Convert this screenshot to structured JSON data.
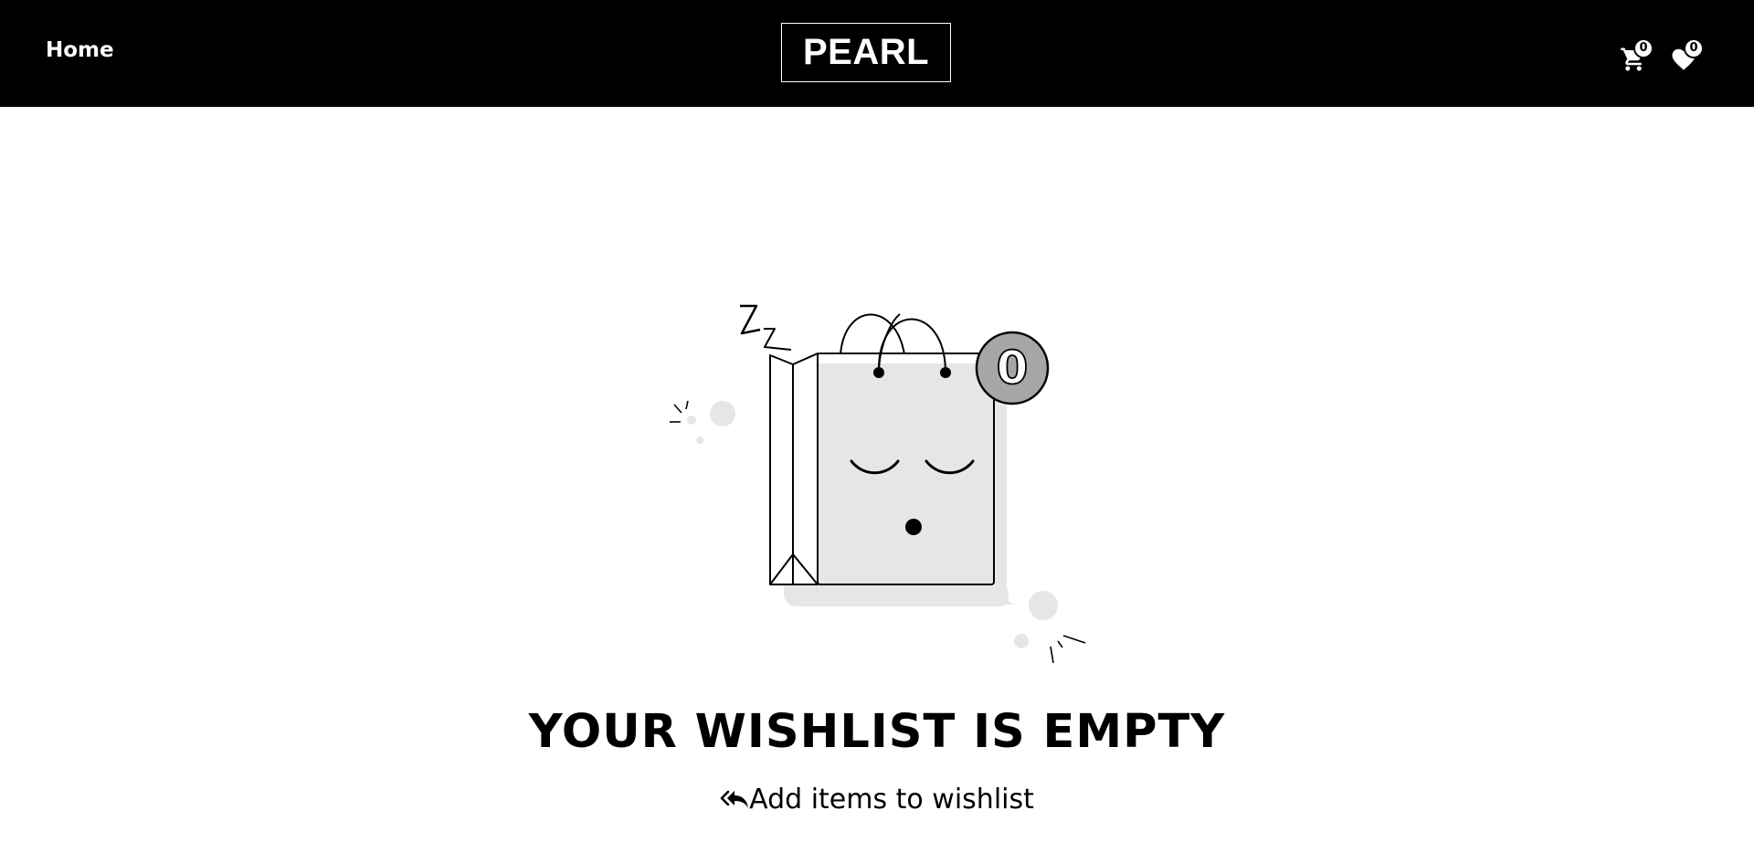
{
  "navbar": {
    "home_label": "Home",
    "brand": "PEARL",
    "cart": {
      "icon": "cart-icon",
      "count": "0"
    },
    "wishlist": {
      "icon": "heart-icon",
      "count": "0"
    }
  },
  "illustration": {
    "badge_count": "0",
    "description_icon": "sleeping-shopping-bag"
  },
  "main": {
    "title": "YOUR WISHLIST IS EMPTY",
    "link_icon": "double-reply-arrow-icon",
    "link_label": "Add items to wishlist"
  },
  "colors": {
    "nav_bg": "#000000",
    "nav_text": "#ffffff",
    "bag_fill": "#e6e6e6",
    "badge_fill": "#a6a6a6"
  }
}
